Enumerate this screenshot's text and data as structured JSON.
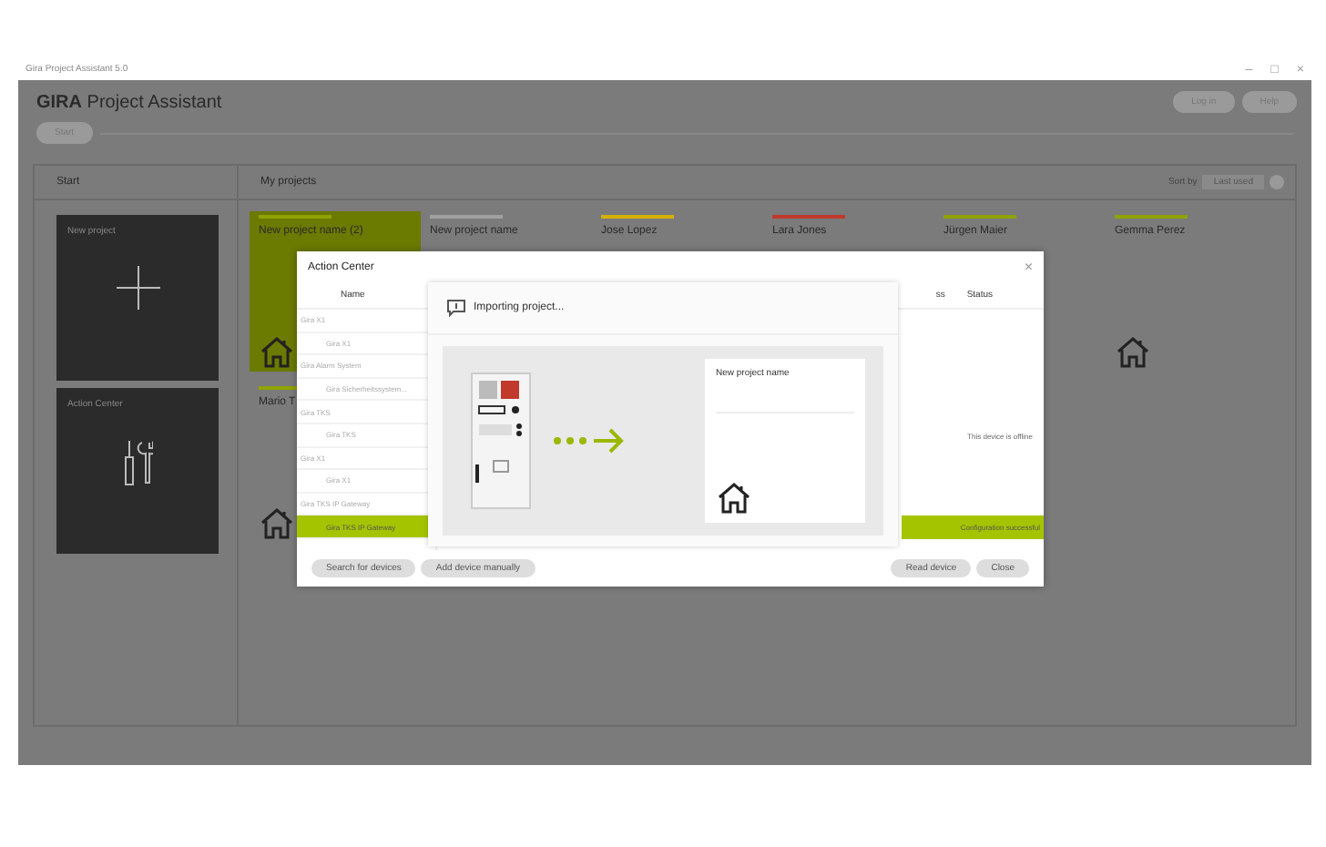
{
  "window": {
    "title": "Gira Project Assistant 5.0",
    "controls": [
      "–",
      "□",
      "×"
    ]
  },
  "header": {
    "brand": "GIRA",
    "product": "Project Assistant",
    "buttons": [
      "Log in",
      "Help"
    ],
    "pill": "Start"
  },
  "start": {
    "title": "Start",
    "tiles": [
      {
        "label": "New project",
        "kind": "plus"
      },
      {
        "label": "Action Center",
        "kind": "tools"
      }
    ]
  },
  "projects": {
    "title": "My projects",
    "sort_label": "Sort by",
    "sort_value": "Last used",
    "items": [
      {
        "name": "New project name (2)",
        "selected": true,
        "color": "#8fa300",
        "house": true
      },
      {
        "name": "New project name",
        "selected": false,
        "color": "#a0a0a0"
      },
      {
        "name": "Jose Lopez",
        "selected": false,
        "color": "#d4b000"
      },
      {
        "name": "Lara Jones",
        "selected": false,
        "color": "#c0392b"
      },
      {
        "name": "Jürgen Maier",
        "selected": false,
        "color": "#8fa300"
      },
      {
        "name": "Gemma Perez",
        "selected": false,
        "color": "#8fa300",
        "house": true
      },
      {
        "name": "Mario T",
        "selected": false,
        "color": "#8fa300",
        "house": true
      }
    ]
  },
  "action_center": {
    "title": "Action Center",
    "close": "×",
    "columns": [
      "Name",
      "ss",
      "Status"
    ],
    "rows": [
      {
        "name": "Gira X1",
        "kind": "group",
        "selected": false
      },
      {
        "name": "Gira X1",
        "kind": "device",
        "selected": false
      },
      {
        "name": "Gira Alarm System",
        "kind": "group",
        "selected": false
      },
      {
        "name": "Gira Sicherheitssystem...",
        "kind": "device",
        "selected": false
      },
      {
        "name": "Gira TKS",
        "kind": "group",
        "selected": false
      },
      {
        "name": "Gira TKS",
        "kind": "device",
        "selected": false,
        "status": "This device is offline"
      },
      {
        "name": "Gira X1",
        "kind": "group",
        "selected": false
      },
      {
        "name": "Gira X1",
        "kind": "device",
        "selected": false
      },
      {
        "name": "Gira TKS IP Gateway",
        "kind": "group",
        "selected": false
      },
      {
        "name": "Gira TKS IP Gateway",
        "kind": "device",
        "selected": true,
        "status": "Configuration successful"
      }
    ],
    "left_buttons": [
      "Search for devices",
      "Add device manually"
    ],
    "right_buttons": [
      "Read device",
      "Close"
    ],
    "import": {
      "message": "Importing project...",
      "target": "New project name"
    }
  }
}
